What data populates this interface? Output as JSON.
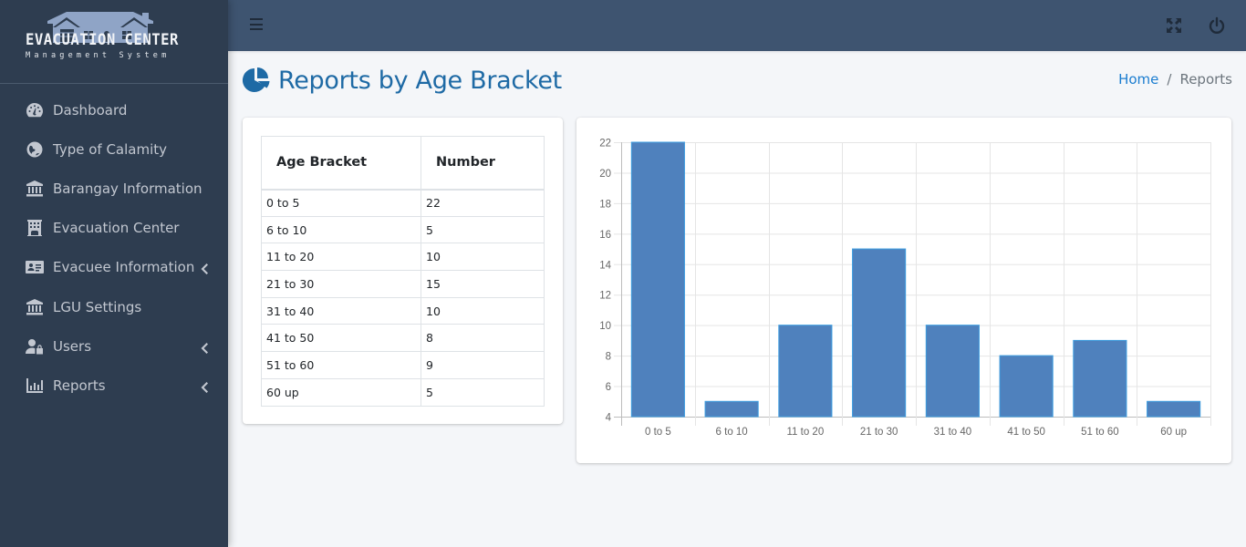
{
  "brand": {
    "title": "EVACUATION CENTER",
    "subtitle": "Management System",
    "logo_icon": "house-icon"
  },
  "sidebar": {
    "items": [
      {
        "label": "Dashboard",
        "icon": "tachometer-icon",
        "has_submenu": false
      },
      {
        "label": "Type of Calamity",
        "icon": "globe-icon",
        "has_submenu": false
      },
      {
        "label": "Barangay Information",
        "icon": "landmark-icon",
        "has_submenu": false
      },
      {
        "label": "Evacuation Center",
        "icon": "building-icon",
        "has_submenu": false
      },
      {
        "label": "Evacuee Information",
        "icon": "id-card-icon",
        "has_submenu": true
      },
      {
        "label": "LGU Settings",
        "icon": "landmark-icon",
        "has_submenu": false
      },
      {
        "label": "Users",
        "icon": "user-lock-icon",
        "has_submenu": true
      },
      {
        "label": "Reports",
        "icon": "bar-chart-icon",
        "has_submenu": true
      }
    ]
  },
  "header": {
    "menu_icon": "hamburger-icon",
    "fullscreen_icon": "expand-icon",
    "logout_icon": "power-icon"
  },
  "page": {
    "title": "Reports by Age Bracket",
    "title_icon": "pie-chart-icon",
    "breadcrumb": {
      "home": "Home",
      "separator": "/",
      "current": "Reports"
    }
  },
  "table": {
    "headers": [
      "Age Bracket",
      "Number"
    ],
    "rows": [
      [
        "0 to 5",
        "22"
      ],
      [
        "6 to 10",
        "5"
      ],
      [
        "11 to 20",
        "10"
      ],
      [
        "21 to 30",
        "15"
      ],
      [
        "31 to 40",
        "10"
      ],
      [
        "41 to 50",
        "8"
      ],
      [
        "51 to 60",
        "9"
      ],
      [
        "60 up",
        "5"
      ]
    ]
  },
  "colors": {
    "sidebar_bg": "#2e3d50",
    "header_bg": "#3e5470",
    "title_blue": "#1e6aa5",
    "bar_fill": "#4f81bd",
    "bar_border": "#3d9de0"
  },
  "chart_data": {
    "type": "bar",
    "title": "",
    "xlabel": "",
    "ylabel": "",
    "categories": [
      "0 to 5",
      "6 to 10",
      "11 to 20",
      "21 to 30",
      "31 to 40",
      "41 to 50",
      "51 to 60",
      "60 up"
    ],
    "values": [
      22,
      5,
      10,
      15,
      10,
      8,
      9,
      5
    ],
    "ylim": [
      4,
      22
    ],
    "yticks": [
      4,
      6,
      8,
      10,
      12,
      14,
      16,
      18,
      20,
      22
    ],
    "grid": true,
    "legend": "none"
  }
}
